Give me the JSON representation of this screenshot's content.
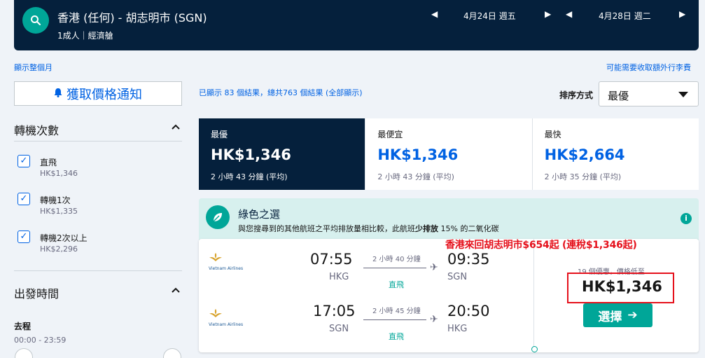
{
  "header": {
    "route": "香港 (任何) - 胡志明市 (SGN)",
    "passengers": "1成人｜經濟艙",
    "depart_date": "4月24日 週五",
    "return_date": "4月28日 週二",
    "prev_symbol": "◀",
    "next_symbol": "▶"
  },
  "links": {
    "show_month": "顯示整個月",
    "extra_fees": "可能需要收取額外行李費"
  },
  "alert_button": {
    "label": "獲取價格通知",
    "icon": "bell-icon"
  },
  "filters": {
    "stops_title": "轉機次數",
    "options": [
      {
        "label": "直飛",
        "price": "HK$1,346",
        "checked": true
      },
      {
        "label": "轉機1次",
        "price": "HK$1,335",
        "checked": true
      },
      {
        "label": "轉機2次以上",
        "price": "HK$2,296",
        "checked": true
      }
    ],
    "time_title": "出發時間",
    "outbound_label": "去程",
    "outbound_range": "00:00 - 23:59"
  },
  "results": {
    "count_text": "已顯示 83 個結果，總共763 個結果 (全部顯示)",
    "sort_label": "排序方式",
    "sort_value": "最優"
  },
  "tabs": [
    {
      "name": "最優",
      "price": "HK$1,346",
      "duration": "2 小時 43 分鐘 (平均)",
      "active": true
    },
    {
      "name": "最便宜",
      "price": "HK$1,346",
      "duration": "2 小時 43 分鐘 (平均)",
      "active": false
    },
    {
      "name": "最快",
      "price": "HK$2,664",
      "duration": "2 小時 35 分鐘 (平均)",
      "active": false
    }
  ],
  "green": {
    "title": "綠色之選",
    "desc_prefix": "與您搜尋到的其他航班之平均排放量相比較，此航班",
    "desc_bold": "少排放",
    "desc_suffix": " 15% 的二氧化碳",
    "info": "i"
  },
  "flight": {
    "airline": "Vietnam Airlines",
    "legs": [
      {
        "dep_time": "07:55",
        "dep_code": "HKG",
        "arr_time": "09:35",
        "arr_code": "SGN",
        "duration": "2 小時 40 分鐘",
        "stops": "直飛"
      },
      {
        "dep_time": "17:05",
        "dep_code": "SGN",
        "arr_time": "20:50",
        "arr_code": "HKG",
        "duration": "2 小時 45 分鐘",
        "stops": "直飛"
      }
    ],
    "deal_count": "19 個優惠，價格低至",
    "price": "HK$1,346",
    "select_label": "選擇",
    "select_arrow": "➔"
  },
  "annotation": {
    "text": "香港來回胡志明市$654起 (連稅$1,346起)"
  },
  "colors": {
    "navy": "#05203c",
    "blue": "#0062e3",
    "teal": "#00a698",
    "annotation_red": "#e5101b"
  }
}
